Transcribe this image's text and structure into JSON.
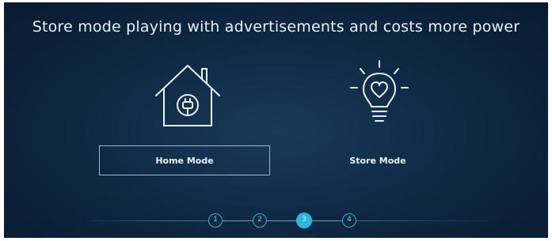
{
  "header": {
    "title": "Store mode playing with advertisements and costs more power"
  },
  "modes": [
    {
      "label": "Home Mode",
      "icon": "home-plug-icon",
      "selected": true
    },
    {
      "label": "Store Mode",
      "icon": "lightbulb-heart-icon",
      "selected": false
    }
  ],
  "stepper": {
    "steps": [
      "1",
      "2",
      "3",
      "4"
    ],
    "active_index": 2
  },
  "colors": {
    "background": "#0f2a45",
    "accent": "#2fb6e0",
    "text": "#e8f0f8"
  }
}
